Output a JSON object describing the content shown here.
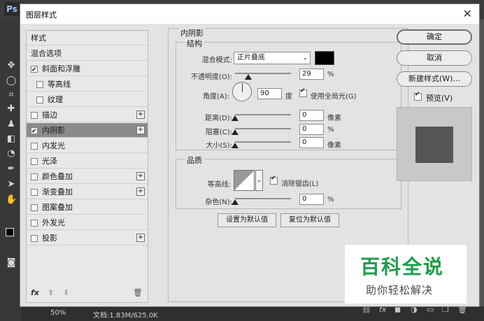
{
  "app": {
    "logo": "Ps"
  },
  "status": {
    "zoom": "50%",
    "doc": "文档:1.83M/625.0K"
  },
  "dialog": {
    "title": "图层样式",
    "left_list": [
      {
        "label": "样式"
      },
      {
        "label": "混合选项"
      },
      {
        "label": "斜面和浮雕",
        "checked": true
      },
      {
        "label": "等高线",
        "checked": false
      },
      {
        "label": "纹理",
        "checked": false
      },
      {
        "label": "描边",
        "checked": false,
        "plus": true
      },
      {
        "label": "内阴影",
        "checked": true,
        "plus": true,
        "selected": true
      },
      {
        "label": "内发光",
        "checked": false
      },
      {
        "label": "光泽",
        "checked": false
      },
      {
        "label": "颜色叠加",
        "checked": false,
        "plus": true
      },
      {
        "label": "渐变叠加",
        "checked": false,
        "plus": true
      },
      {
        "label": "图案叠加",
        "checked": false
      },
      {
        "label": "外发光",
        "checked": false
      },
      {
        "label": "投影",
        "checked": false,
        "plus": true
      }
    ],
    "left_bottom": {
      "fx": "fx",
      "up": "⬆",
      "down": "⬇",
      "trash": "🗑"
    },
    "section_title": "内阴影",
    "structure": {
      "title": "结构",
      "blend_label": "混合模式:",
      "blend_value": "正片叠底",
      "opacity_label": "不透明度(O):",
      "opacity_value": "29",
      "opacity_unit": "%",
      "angle_label": "角度(A):",
      "angle_value": "90",
      "angle_unit": "度",
      "global_light_label": "使用全局光(G)",
      "distance_label": "距离(D):",
      "distance_value": "0",
      "distance_unit": "像素",
      "choke_label": "阻塞(C):",
      "choke_value": "0",
      "choke_unit": "%",
      "size_label": "大小(S):",
      "size_value": "0",
      "size_unit": "像素"
    },
    "quality": {
      "title": "品质",
      "contour_label": "等高线:",
      "antialias_label": "消除锯齿(L)",
      "noise_label": "杂色(N):",
      "noise_value": "0",
      "noise_unit": "%"
    },
    "buttons": {
      "set_default": "设置为默认值",
      "reset_default": "复位为默认值",
      "ok": "确定",
      "cancel": "取消",
      "new_style": "新建样式(W)...",
      "preview": "预览(V)"
    }
  },
  "watermark": {
    "line1": "百科全说",
    "line2": "助你轻松解决"
  }
}
